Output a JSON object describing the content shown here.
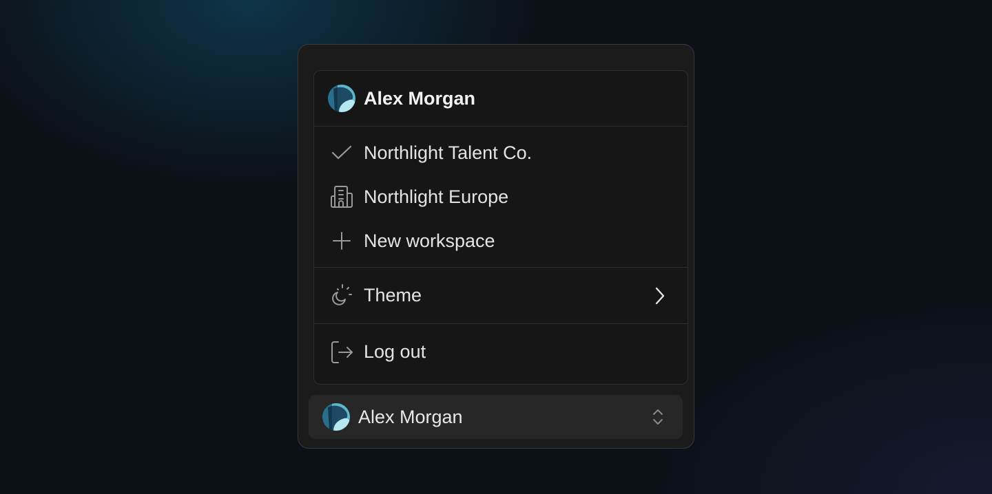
{
  "user": {
    "name": "Alex Morgan",
    "avatar": "avatar-image"
  },
  "menu": {
    "workspaces": [
      {
        "label": "Northlight Talent Co.",
        "icon": "check-icon",
        "selected": true
      },
      {
        "label": "Northlight Europe",
        "icon": "building-icon",
        "selected": false
      },
      {
        "label": "New workspace",
        "icon": "plus-icon",
        "selected": false
      }
    ],
    "theme": {
      "label": "Theme",
      "icon": "theme-icon",
      "submenu_icon": "chevron-right-icon"
    },
    "logout": {
      "label": "Log out",
      "icon": "log-out-icon"
    }
  },
  "trigger": {
    "name": "Alex Morgan",
    "icon": "chevrons-up-down-icon"
  },
  "colors": {
    "avatar_dark": "#1e4a66",
    "avatar_light": "#a8e3ec",
    "text_primary": "#f2f2f2",
    "icon_stroke": "#9a9a9a"
  }
}
